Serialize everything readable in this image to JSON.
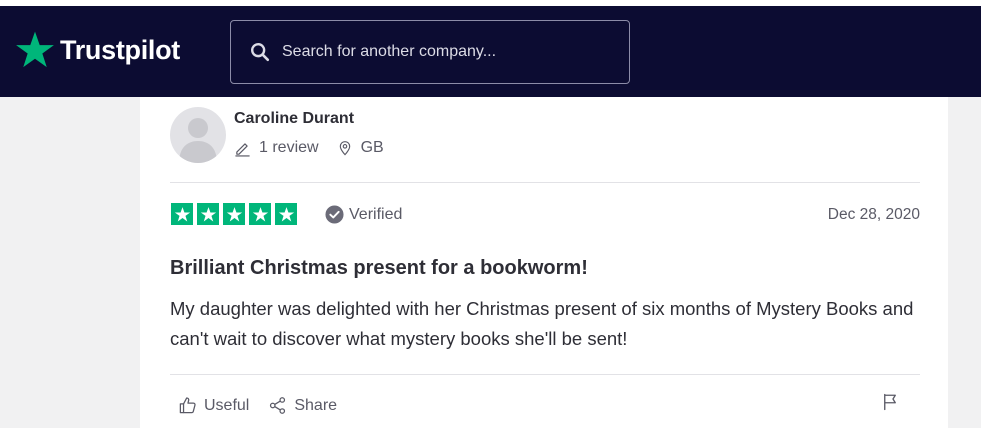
{
  "header": {
    "brand": "Trustpilot",
    "search": {
      "placeholder": "Search for another company..."
    }
  },
  "review": {
    "reviewer": {
      "name": "Caroline Durant",
      "review_count": "1 review",
      "country": "GB"
    },
    "rating": 5,
    "verified_label": "Verified",
    "date": "Dec 28, 2020",
    "title": "Brilliant Christmas present for a bookworm!",
    "body": "My daughter was delighted with her Christmas present of six months of Mystery Books and can't wait to discover what mystery books she'll be sent!",
    "actions": {
      "useful": "Useful",
      "share": "Share"
    }
  },
  "colors": {
    "header_bg": "#0c0c32",
    "star_green": "#00b67a",
    "text_dark": "#2e2e36",
    "text_muted": "#5a5a66"
  },
  "icons": [
    "trustpilot-star-icon",
    "search-icon",
    "pencil-icon",
    "location-pin-icon",
    "verified-check-icon",
    "thumbs-up-icon",
    "share-icon",
    "flag-icon"
  ]
}
